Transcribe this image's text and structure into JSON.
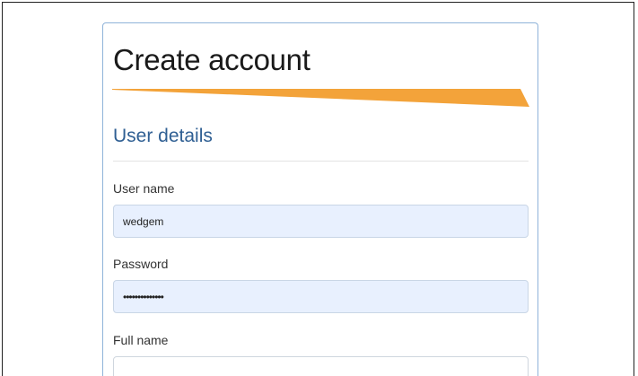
{
  "form": {
    "title": "Create account",
    "accent_color": "#f3a33a",
    "section_title": "User details",
    "fields": {
      "username": {
        "label": "User name",
        "value": "wedgem"
      },
      "password": {
        "label": "Password",
        "value": "••••••••••••••"
      },
      "fullname": {
        "label": "Full name",
        "value": ""
      }
    }
  }
}
